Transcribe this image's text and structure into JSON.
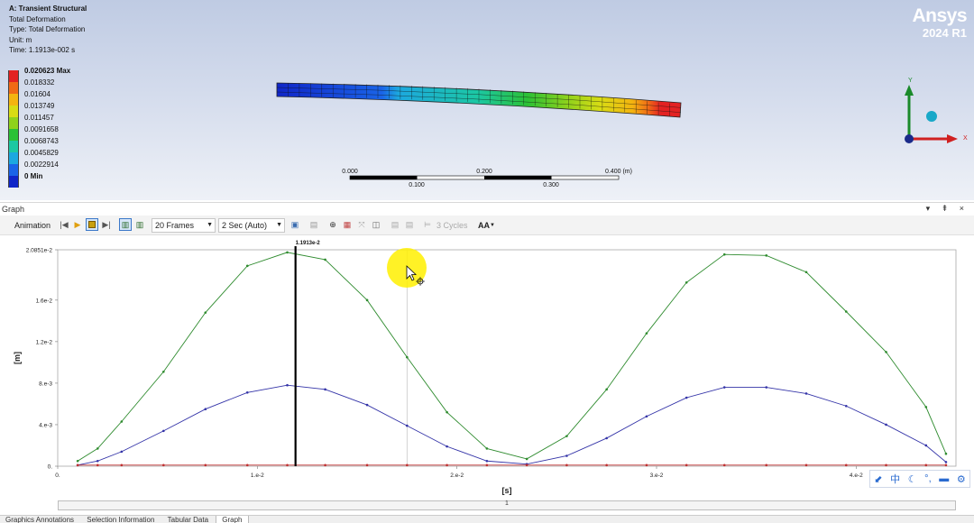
{
  "analysis_info": {
    "system": "A: Transient Structural",
    "result": "Total Deformation",
    "type": "Type: Total Deformation",
    "unit": "Unit: m",
    "time": "Time: 1.1913e-002 s"
  },
  "legend": {
    "items": [
      {
        "label": "0.020623 Max",
        "color": "#e32222",
        "bold": true
      },
      {
        "label": "0.018332",
        "color": "#f06a16",
        "bold": false
      },
      {
        "label": "0.01604",
        "color": "#f4b410",
        "bold": false
      },
      {
        "label": "0.013749",
        "color": "#d8dc14",
        "bold": false
      },
      {
        "label": "0.011457",
        "color": "#8fd21c",
        "bold": false
      },
      {
        "label": "0.0091658",
        "color": "#2bc136",
        "bold": false
      },
      {
        "label": "0.0068743",
        "color": "#1cc8a2",
        "bold": false
      },
      {
        "label": "0.0045829",
        "color": "#1ca8e0",
        "bold": false
      },
      {
        "label": "0.0022914",
        "color": "#1a64e8",
        "bold": false
      },
      {
        "label": "0 Min",
        "color": "#1026c8",
        "bold": true
      }
    ]
  },
  "brand": {
    "name": "Ansys",
    "version": "2024 R1"
  },
  "scale_bar": {
    "top": [
      "0.000",
      "0.200",
      "0.400 (m)"
    ],
    "bottom": [
      "0.100",
      "0.300"
    ]
  },
  "triad": {
    "x": "X",
    "y": "Y"
  },
  "graph_panel": {
    "title": "Graph",
    "controls": "▾ ⇞ ×"
  },
  "toolbar": {
    "animation_label": "Animation",
    "frames": "20 Frames",
    "speed": "2 Sec (Auto)",
    "cycles": "3 Cycles",
    "aa": "AA"
  },
  "chart_data": {
    "type": "line",
    "title": "",
    "xlabel": "[s]",
    "ylabel": "[m]",
    "xlim": [
      0,
      0.045
    ],
    "ylim": [
      0,
      0.020851
    ],
    "yticks": [
      0,
      0.004,
      0.008,
      0.012,
      0.016,
      0.020851
    ],
    "ytick_labels": [
      "0.",
      "4.e-3",
      "8.e-3",
      "1.2e-2",
      "1.6e-2",
      "2.0851e-2"
    ],
    "xticks": [
      0,
      0.01,
      0.02,
      0.03,
      0.04
    ],
    "xtick_labels": [
      "0.",
      "1.e-2",
      "2.e-2",
      "3.e-2",
      "4.e-2"
    ],
    "current_time": 0.011913,
    "current_time_label": "1.1913e-2",
    "hover_time": 0.0175,
    "x": [
      0.001,
      0.002,
      0.0032,
      0.0053,
      0.0074,
      0.0095,
      0.0115,
      0.0134,
      0.0155,
      0.0175,
      0.0195,
      0.0215,
      0.0235,
      0.0255,
      0.0275,
      0.0295,
      0.0315,
      0.0334,
      0.0355,
      0.0375,
      0.0395,
      0.0415,
      0.0435,
      0.0445
    ],
    "series": [
      {
        "color": "#2e8b2e",
        "values": [
          0.0005,
          0.0017,
          0.0043,
          0.0091,
          0.0148,
          0.0193,
          0.0206,
          0.0199,
          0.016,
          0.0105,
          0.0052,
          0.0017,
          0.0007,
          0.0029,
          0.0074,
          0.0128,
          0.0177,
          0.0204,
          0.0203,
          0.0187,
          0.0149,
          0.011,
          0.0057,
          0.0012
        ]
      },
      {
        "color": "#3434a8",
        "values": [
          0.0001,
          0.0005,
          0.0014,
          0.0034,
          0.0055,
          0.0071,
          0.0078,
          0.0074,
          0.0059,
          0.0039,
          0.0019,
          0.0005,
          0.0002,
          0.001,
          0.0027,
          0.0048,
          0.0066,
          0.0076,
          0.0076,
          0.007,
          0.0058,
          0.004,
          0.002,
          0.0004
        ]
      },
      {
        "color": "#c03030",
        "values": [
          0.0001,
          0.0001,
          0.0001,
          0.0001,
          0.0001,
          0.0001,
          0.0001,
          0.0001,
          0.0001,
          0.0001,
          0.0001,
          0.0001,
          0.0001,
          0.0001,
          0.0001,
          0.0001,
          0.0001,
          0.0001,
          0.0001,
          0.0001,
          0.0001,
          0.0001,
          0.0001,
          0.0001
        ]
      }
    ]
  },
  "scroll_page": "1",
  "bottom_tabs": [
    "Graphics Annotations",
    "Selection Information",
    "Tabular Data",
    "Graph"
  ]
}
